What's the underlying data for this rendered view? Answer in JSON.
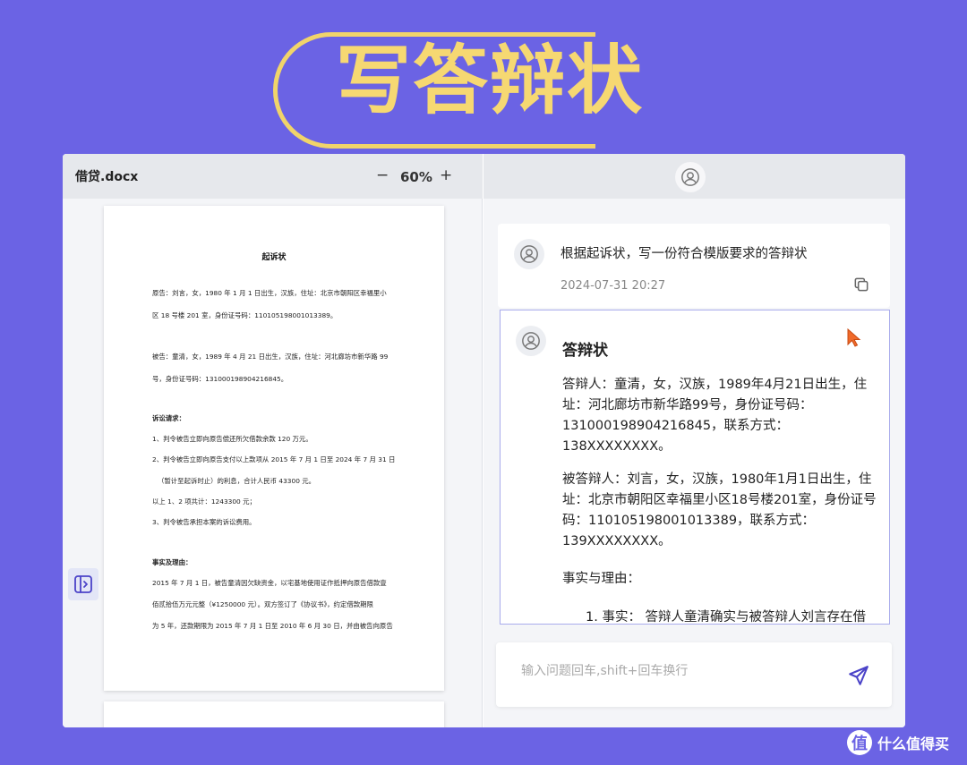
{
  "banner": {
    "title": "写答辩状"
  },
  "document_panel": {
    "file_name": "借贷.docx",
    "zoom_minus": "−",
    "zoom_value": "60%",
    "zoom_plus": "+",
    "page": {
      "title": "起诉状",
      "lines": [
        {
          "text": "原告：刘言，女，1980 年 1 月 1 日出生，汉族，住址：北京市朝阳区幸福里小",
          "bold": false
        },
        {
          "text": "区 18 号楼 201 室，身份证号码：110105198001013389。",
          "bold": false
        },
        {
          "text": "被告：童清，女，1989 年 4 月 21 日出生，汉族，住址：河北廊坊市新华路 99",
          "bold": false
        },
        {
          "text": "号，身份证号码：131000198904216845。",
          "bold": false
        },
        {
          "text": "诉讼请求：",
          "bold": true
        },
        {
          "text": "1、判令被告立即向原告偿还所欠借款余款 120 万元。",
          "bold": false
        },
        {
          "text": "2、判令被告立即向原告支付以上款项从 2015 年 7 月 1 日至 2024 年 7 月 31 日",
          "bold": false
        },
        {
          "text": "（暂计至起诉时止）的利息，合计人民币 43300 元。",
          "bold": false
        },
        {
          "text": "以上 1、2 项共计：1243300 元；",
          "bold": false
        },
        {
          "text": "3、判令被告承担本案的诉讼费用。",
          "bold": false
        },
        {
          "text": "事实及理由：",
          "bold": true
        },
        {
          "text": "2015 年 7 月 1 日，被告童清因欠缺资金，以宅基地使用证作抵押向原告借款壹",
          "bold": false
        },
        {
          "text": "佰贰拾伍万元元整（¥1250000 元）。双方签订了《协议书》，约定借款期限",
          "bold": false
        },
        {
          "text": "为 5 年，还款期限为 2015 年 7 月 1 日至 2010 年 6 月 30 日，并由被告向原告",
          "bold": false
        }
      ]
    }
  },
  "chat": {
    "question": {
      "text": "根据起诉状，写一份符合模版要求的答辩状",
      "time": "2024-07-31 20:27"
    },
    "answer": {
      "title": "答辩状",
      "paragraphs": [
        "答辩人：童清，女，汉族，1989年4月21日出生，住址：河北廊坊市新华路99号，身份证号码：131000198904216845，联系方式：138XXXXXXXX。",
        "被答辩人：刘言，女，汉族，1980年1月1日出生，住址：北京市朝阳区幸福里小区18号楼201室，身份证号码：110105198001013389，联系方式：139XXXXXXXX。",
        "事实与理由：",
        "1. 事实：  答辩人童清确实与被答辩人刘言存在借"
      ]
    },
    "input": {
      "placeholder": "输入问题回车,shift+回车换行",
      "value": ""
    }
  },
  "watermark": {
    "logo": "值",
    "text": "什么值得买"
  },
  "colors": {
    "background": "#6b63e4",
    "banner_gold": "#f6d872",
    "accent": "#4b43c8"
  }
}
